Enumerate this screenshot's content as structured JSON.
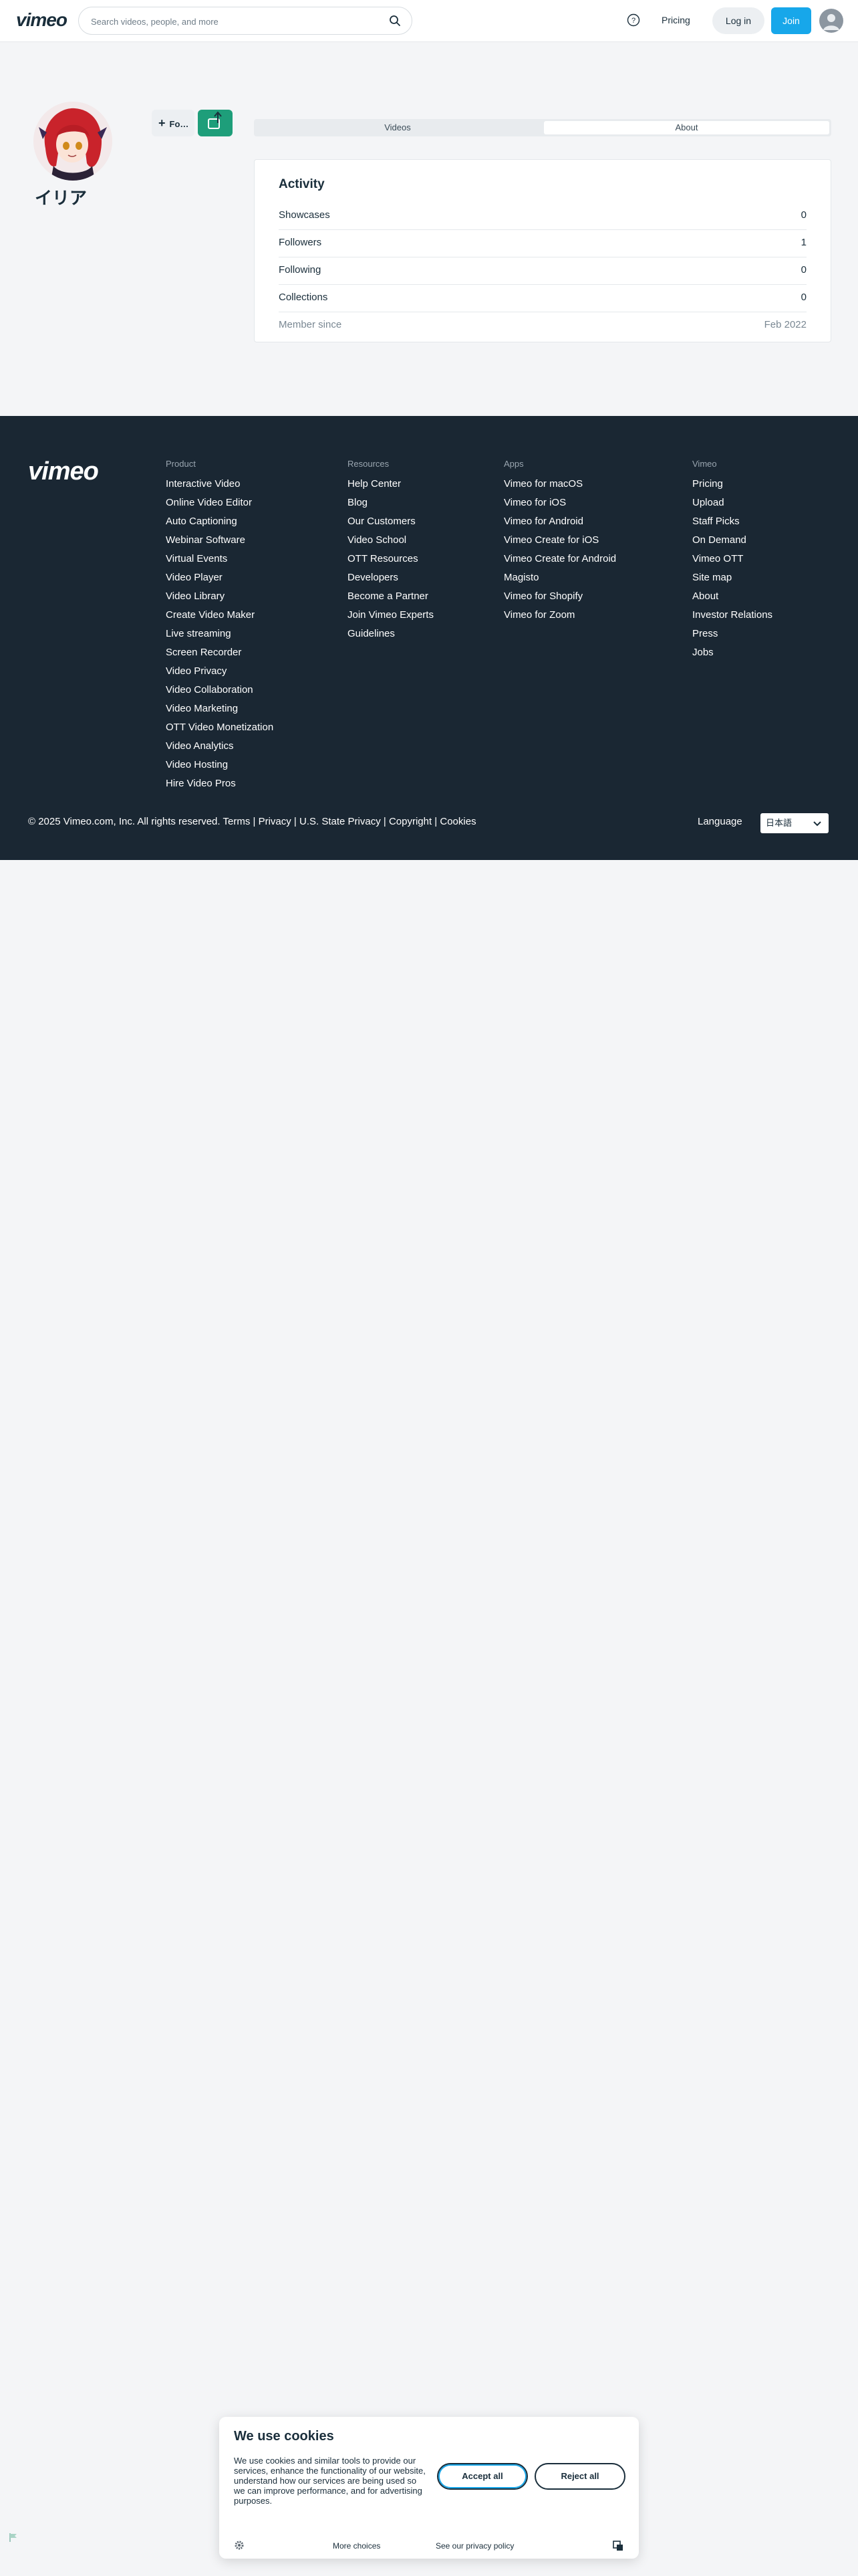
{
  "header": {
    "logo": "vimeo",
    "search_placeholder": "Search videos, people, and more",
    "pricing": "Pricing",
    "login": "Log in",
    "join": "Join"
  },
  "profile": {
    "name": "イリア",
    "follow_label": "Fo…",
    "tabs": [
      "Videos",
      "About"
    ],
    "active_tab": "About"
  },
  "activity": {
    "title": "Activity",
    "rows": [
      {
        "label": "Showcases",
        "value": "0"
      },
      {
        "label": "Followers",
        "value": "1"
      },
      {
        "label": "Following",
        "value": "0"
      },
      {
        "label": "Collections",
        "value": "0"
      },
      {
        "label": "Member since",
        "value": "Feb 2022"
      }
    ]
  },
  "footer": {
    "logo": "vimeo",
    "columns": [
      {
        "heading": "Product",
        "links": [
          "Interactive Video",
          "Online Video Editor",
          "Auto Captioning",
          "Webinar Software",
          "Virtual Events",
          "Video Player",
          "Video Library",
          "Create Video Maker",
          "Live streaming",
          "Screen Recorder",
          "Video Privacy",
          "Video Collaboration",
          "Video Marketing",
          "OTT Video Monetization",
          "Video Analytics",
          "Video Hosting",
          "Hire Video Pros"
        ]
      },
      {
        "heading": "Resources",
        "links": [
          "Help Center",
          "Blog",
          "Our Customers",
          "Video School",
          "OTT Resources",
          "Developers",
          "Become a Partner",
          "Join Vimeo Experts",
          "Guidelines"
        ]
      },
      {
        "heading": "Apps",
        "links": [
          "Vimeo for macOS",
          "Vimeo for iOS",
          "Vimeo for Android",
          "Vimeo Create for iOS",
          "Vimeo Create for Android",
          "Magisto",
          "Vimeo for Shopify",
          "Vimeo for Zoom"
        ]
      },
      {
        "heading": "Vimeo",
        "links": [
          "Pricing",
          "Upload",
          "Staff Picks",
          "On Demand",
          "Vimeo OTT",
          "Site map",
          "About",
          "Investor Relations",
          "Press",
          "Jobs"
        ]
      }
    ],
    "copyright": "© 2025 Vimeo.com, Inc. All rights reserved.",
    "legal_links": [
      "Terms",
      "Privacy",
      "U.S. State Privacy",
      "Copyright",
      "Cookies"
    ],
    "language_label": "Language",
    "language_value": "日本語"
  },
  "cookie": {
    "title": "We use cookies",
    "description": "We use cookies and similar tools to provide our services, enhance the functionality of our website, understand how our services are being used so we can improve performance, and for advertising purposes.",
    "accept": "Accept all",
    "reject": "Reject all",
    "more_choices": "More choices",
    "privacy_link": "See our privacy policy"
  },
  "colors": {
    "accent": "#17a7ea",
    "share_button": "#1e9e7a",
    "footer_bg": "#1a2733",
    "text": "#1a2e3b"
  }
}
